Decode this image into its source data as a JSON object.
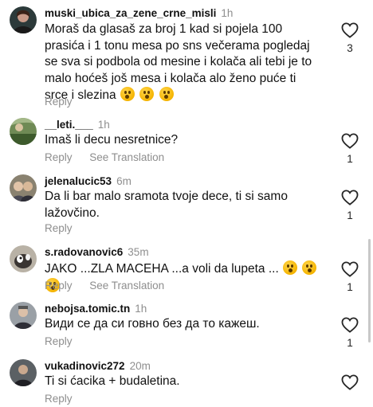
{
  "comments": [
    {
      "username": "muski_ubica_za_zene_crne_misli",
      "time": "1h",
      "text": "Moraš da glasaš za broj 1 kad si pojela 100 prasića i 1 tonu mesa po sns večerama pogledaj se sva si podbola od mesine i kolača ali tebi je to malo hoćeš još mesa i kolača alo ženo puće ti srce i slezina",
      "emoji_count": 3,
      "reply_label": "Reply",
      "translation_label": "",
      "likes": "3"
    },
    {
      "username": "__leti.___",
      "time": "1h",
      "text": "Imaš li decu nesretnice?",
      "emoji_count": 0,
      "reply_label": "Reply",
      "translation_label": "See Translation",
      "likes": "1"
    },
    {
      "username": "jelenalucic53",
      "time": "6m",
      "text": "Da li bar malo sramota tvoje dece, ti si samo lažovčino.",
      "emoji_count": 0,
      "reply_label": "Reply",
      "translation_label": "",
      "likes": "1"
    },
    {
      "username": "s.radovanovic6",
      "time": "35m",
      "text": "JAKO ...ZLA MACEHA ...a voli da lupeta ...",
      "emoji_count": 3,
      "reply_label": "Reply",
      "translation_label": "See Translation",
      "likes": "1"
    },
    {
      "username": "nebojsa.tomic.tn",
      "time": "1h",
      "text": "Види се да си говно без да то кажеш.",
      "emoji_count": 0,
      "reply_label": "Reply",
      "translation_label": "",
      "likes": "1"
    },
    {
      "username": "vukadinovic272",
      "time": "20m",
      "text": "Ti si ćacika + budaletina.",
      "emoji_count": 0,
      "reply_label": "Reply",
      "translation_label": "",
      "likes": ""
    }
  ],
  "icons": {
    "like": "heart-outline-icon",
    "emoji": "astonished-face-emoji"
  },
  "colors": {
    "meta_gray": "#8e8e8e",
    "text": "#111111"
  }
}
